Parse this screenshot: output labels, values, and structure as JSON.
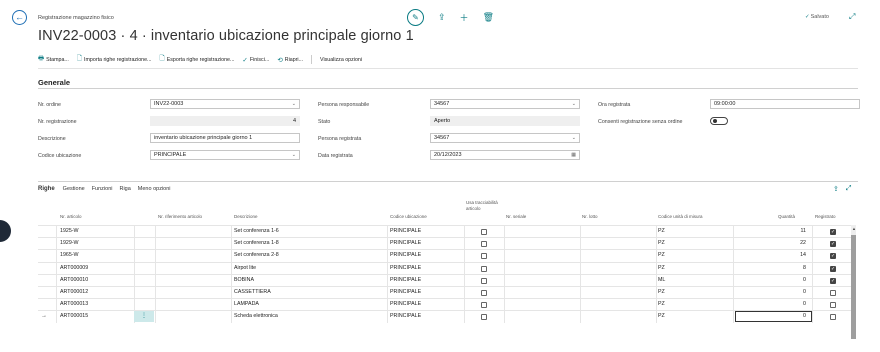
{
  "header": {
    "breadcrumb": "Registrazione magazzino fisico",
    "title": "INV22-0003 · 4 · inventario ubicazione principale giorno 1",
    "saved_label": "Salvato"
  },
  "actions": [
    {
      "icon": "print-icon",
      "label": "Stampa..."
    },
    {
      "icon": "import-icon",
      "label": "Importa righe registrazione..."
    },
    {
      "icon": "export-icon",
      "label": "Esporta righe registrazione..."
    },
    {
      "icon": "check-icon",
      "label": "Finisci..."
    },
    {
      "icon": "reopen-icon",
      "label": "Riapri..."
    },
    {
      "icon": "",
      "label": "Visualizza opzioni"
    }
  ],
  "general": {
    "section_title": "Generale",
    "order_no": {
      "label": "Nr. ordine",
      "value": "INV22-0003"
    },
    "reg_no": {
      "label": "Nr. registrazione",
      "value": "4"
    },
    "description": {
      "label": "Descrizione",
      "value": "inventario ubicazione principale giorno 1"
    },
    "location_code": {
      "label": "Codice ubicazione",
      "value": "PRINCIPALE"
    },
    "responsible": {
      "label": "Persona responsabile",
      "value": "34567"
    },
    "status": {
      "label": "Stato",
      "value": "Aperto"
    },
    "recorded_by": {
      "label": "Persona registrata",
      "value": "34567"
    },
    "recorded_date": {
      "label": "Data registrata",
      "value": "20/12/2023"
    },
    "recorded_time": {
      "label": "Ora registrata",
      "value": "09:00:00"
    },
    "allow_without_order": {
      "label": "Consenti registrazione senza ordine",
      "value": false
    }
  },
  "lines": {
    "tabs": [
      "Righe",
      "Gestione",
      "Funzioni",
      "Riga",
      "Meno opzioni"
    ],
    "columns": [
      "Nr. articolo",
      "Nr. riferimento articolo",
      "Descrizione",
      "Codice ubicazione",
      "Usa tracciabilità articolo",
      "Nr. seriale",
      "Nr. lotto",
      "Codice unità di misura",
      "Quantità",
      "Registrato"
    ],
    "rows": [
      {
        "item": "1925-W",
        "ref": "",
        "desc": "Set conferenza 1-6",
        "loc": "PRINCIPALE",
        "track": false,
        "serial": "",
        "lot": "",
        "uom": "PZ",
        "qty": "11",
        "recorded": true
      },
      {
        "item": "1929-W",
        "ref": "",
        "desc": "Set conferenza 1-8",
        "loc": "PRINCIPALE",
        "track": false,
        "serial": "",
        "lot": "",
        "uom": "PZ",
        "qty": "22",
        "recorded": true
      },
      {
        "item": "1965-W",
        "ref": "",
        "desc": "Set conferenza 2-8",
        "loc": "PRINCIPALE",
        "track": false,
        "serial": "",
        "lot": "",
        "uom": "PZ",
        "qty": "14",
        "recorded": true
      },
      {
        "item": "ART000009",
        "ref": "",
        "desc": "Airpot lite",
        "loc": "PRINCIPALE",
        "track": false,
        "serial": "",
        "lot": "",
        "uom": "PZ",
        "qty": "8",
        "recorded": true
      },
      {
        "item": "ART000010",
        "ref": "",
        "desc": "BOBINA",
        "loc": "PRINCIPALE",
        "track": false,
        "serial": "",
        "lot": "",
        "uom": "ML",
        "qty": "0",
        "recorded": true
      },
      {
        "item": "ART000012",
        "ref": "",
        "desc": "CASSETTIERA",
        "loc": "PRINCIPALE",
        "track": false,
        "serial": "",
        "lot": "",
        "uom": "PZ",
        "qty": "0",
        "recorded": false
      },
      {
        "item": "ART000013",
        "ref": "",
        "desc": "LAMPADA",
        "loc": "PRINCIPALE",
        "track": false,
        "serial": "",
        "lot": "",
        "uom": "PZ",
        "qty": "0",
        "recorded": false
      },
      {
        "item": "ART000015",
        "ref": "",
        "desc": "Scheda elettronica",
        "loc": "PRINCIPALE",
        "track": false,
        "serial": "",
        "lot": "",
        "uom": "PZ",
        "qty": "0",
        "recorded": false
      }
    ]
  }
}
